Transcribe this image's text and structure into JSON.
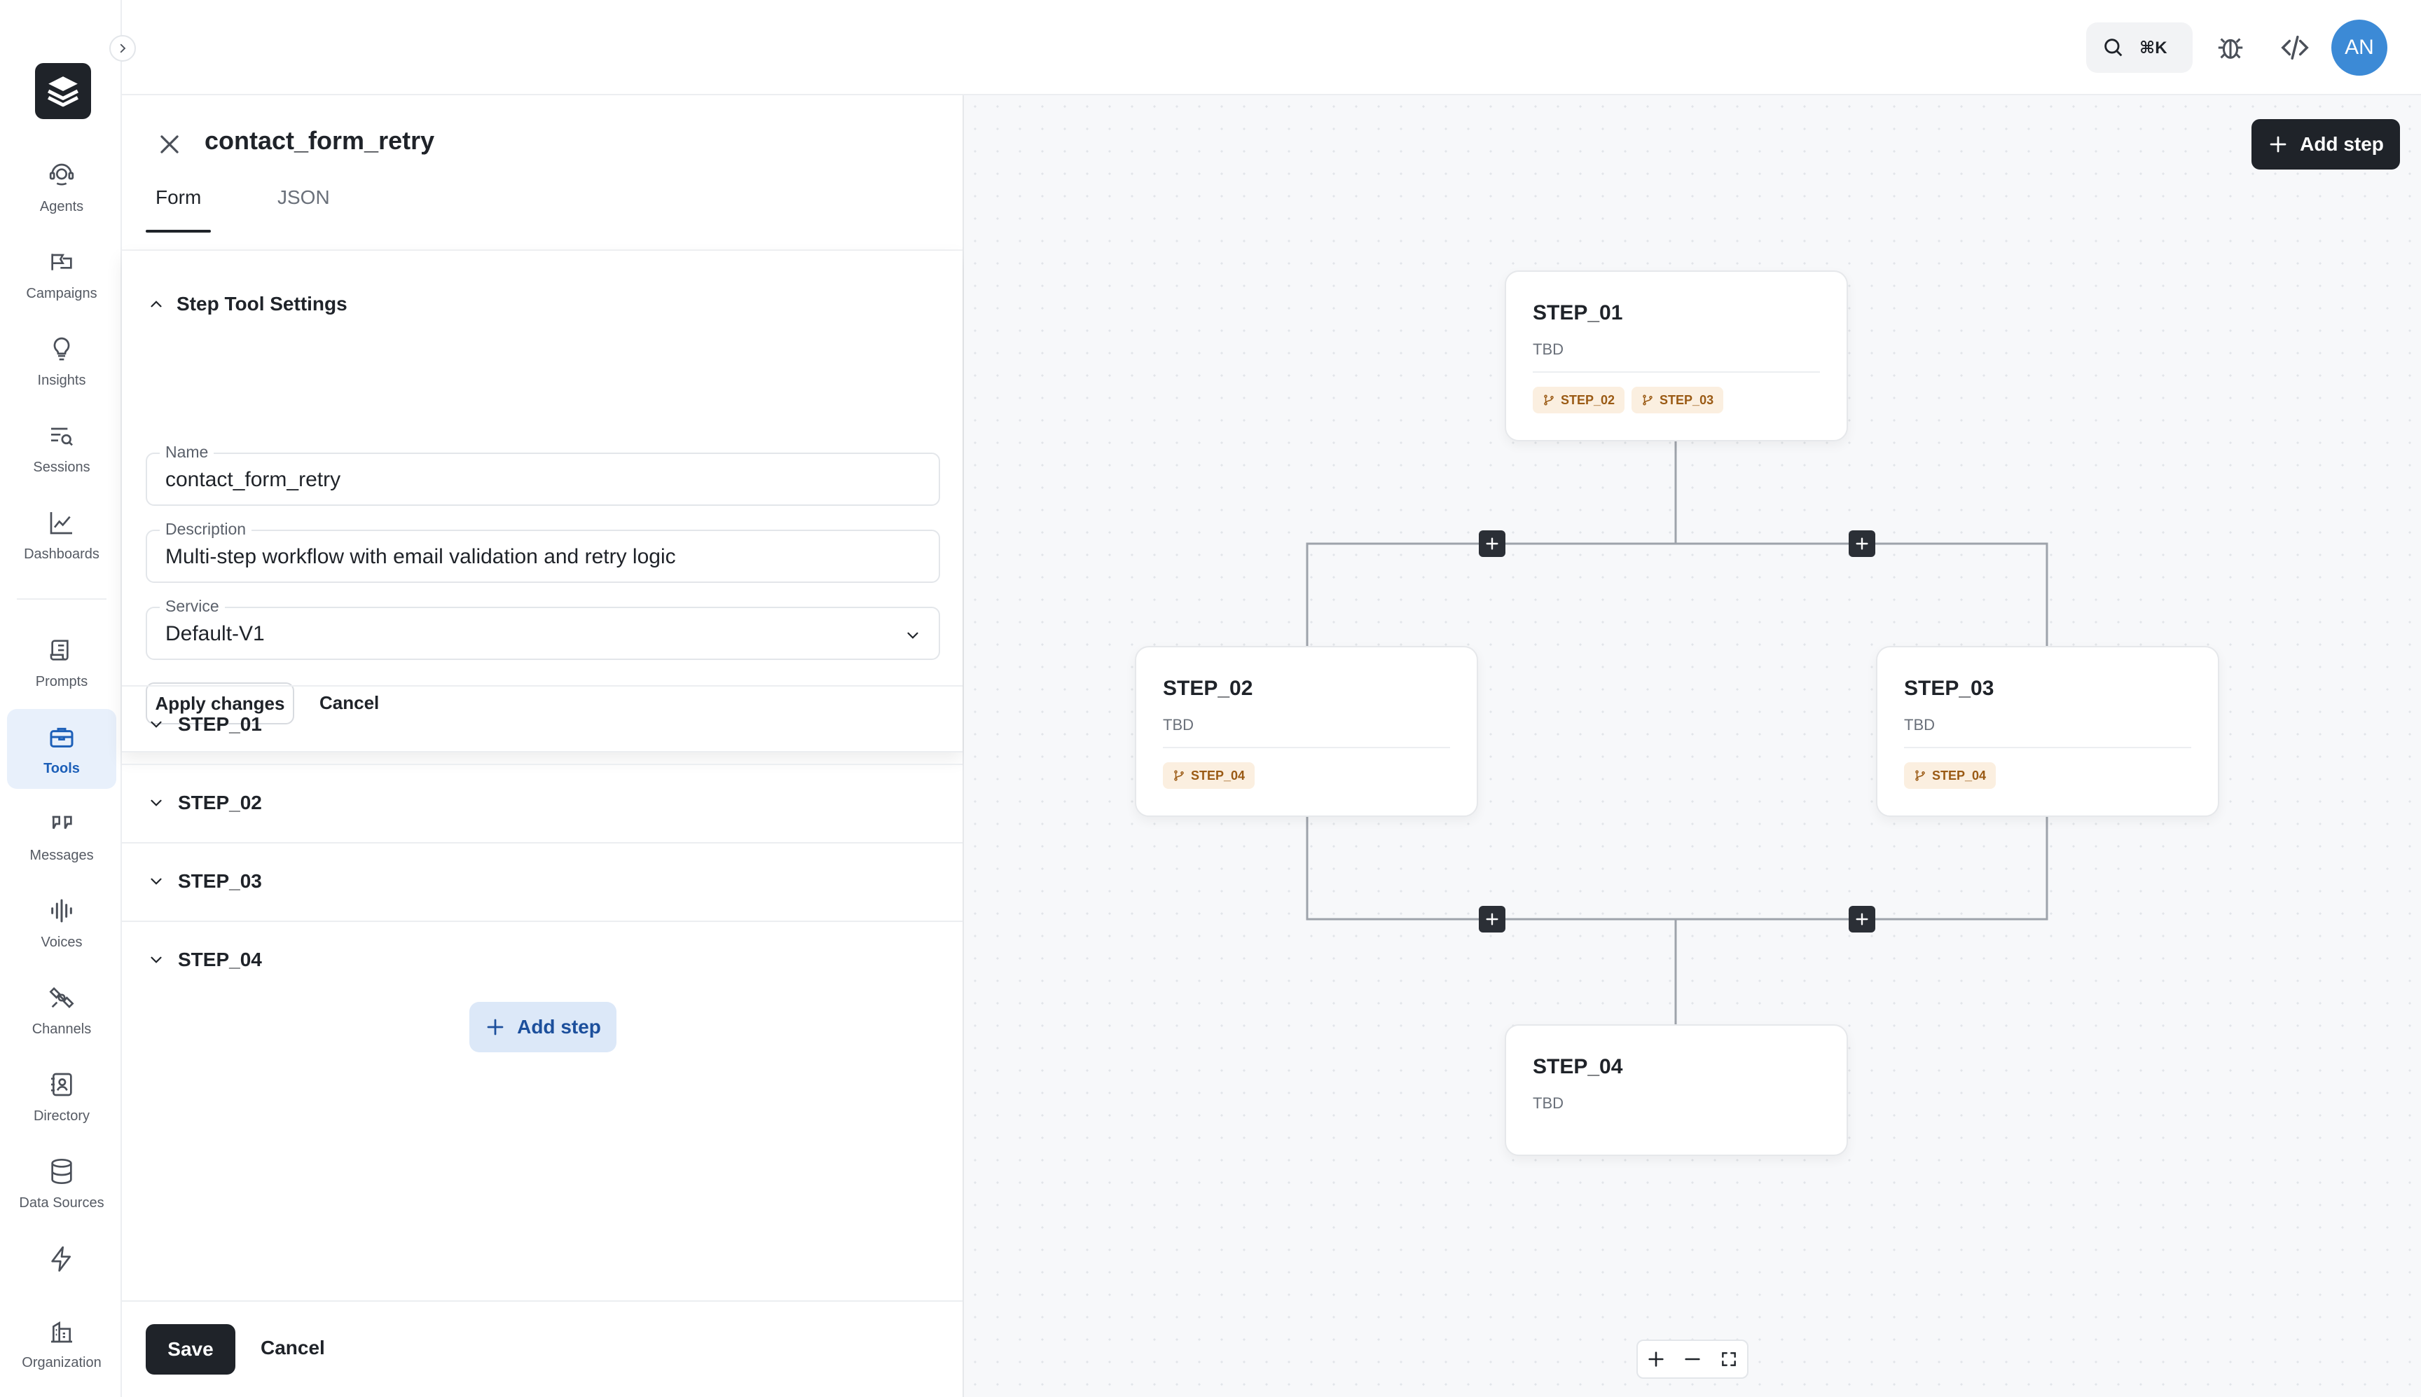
{
  "nav": {
    "items": [
      {
        "label": "Agents",
        "icon": "agents-icon"
      },
      {
        "label": "Campaigns",
        "icon": "megaphone-icon"
      },
      {
        "label": "Insights",
        "icon": "lightbulb-icon"
      },
      {
        "label": "Sessions",
        "icon": "sessions-icon"
      },
      {
        "label": "Dashboards",
        "icon": "chart-icon"
      },
      {
        "label": "Prompts",
        "icon": "scroll-icon"
      },
      {
        "label": "Tools",
        "icon": "toolbox-icon",
        "active": true
      },
      {
        "label": "Messages",
        "icon": "quote-icon"
      },
      {
        "label": "Voices",
        "icon": "waveform-icon"
      },
      {
        "label": "Channels",
        "icon": "satellite-icon"
      },
      {
        "label": "Directory",
        "icon": "contact-book-icon"
      },
      {
        "label": "Data Sources",
        "icon": "database-icon"
      },
      {
        "label": "",
        "icon": "lightning-icon"
      },
      {
        "label": "Organization",
        "icon": "building-icon"
      }
    ]
  },
  "topbar": {
    "search_shortcut": "⌘K",
    "avatar_initials": "AN"
  },
  "panel": {
    "title": "contact_form_retry",
    "tabs": [
      {
        "label": "Form",
        "active": true
      },
      {
        "label": "JSON",
        "active": false
      }
    ],
    "settings": {
      "section_title": "Step Tool Settings",
      "name_label": "Name",
      "name_value": "contact_form_retry",
      "description_label": "Description",
      "description_value": "Multi-step workflow with email validation and retry logic",
      "service_label": "Service",
      "service_value": "Default-V1",
      "apply_label": "Apply changes",
      "cancel_label": "Cancel"
    },
    "steps": [
      "STEP_01",
      "STEP_02",
      "STEP_03",
      "STEP_04"
    ],
    "add_step_label": "Add step",
    "footer": {
      "save_label": "Save",
      "cancel_label": "Cancel"
    }
  },
  "canvas": {
    "add_step_label": "Add step",
    "nodes": [
      {
        "title": "STEP_01",
        "subtitle": "TBD",
        "tags": [
          "STEP_02",
          "STEP_03"
        ]
      },
      {
        "title": "STEP_02",
        "subtitle": "TBD",
        "tags": [
          "STEP_04"
        ]
      },
      {
        "title": "STEP_03",
        "subtitle": "TBD",
        "tags": [
          "STEP_04"
        ]
      },
      {
        "title": "STEP_04",
        "subtitle": "TBD",
        "tags": []
      }
    ]
  },
  "colors": {
    "accent": "#1c5fb8",
    "dark": "#1f2329",
    "tag_bg": "#fbefe0",
    "tag_text": "#9a5a14",
    "avatar": "#3c8ad6"
  }
}
